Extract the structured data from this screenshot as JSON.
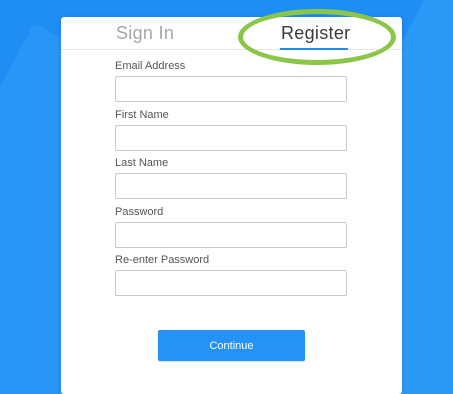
{
  "tabs": {
    "signin_label": "Sign In",
    "register_label": "Register"
  },
  "form": {
    "fields": [
      {
        "label": "Email Address",
        "value": ""
      },
      {
        "label": "First Name",
        "value": ""
      },
      {
        "label": "Last Name",
        "value": ""
      },
      {
        "label": "Password",
        "value": ""
      },
      {
        "label": "Re-enter Password",
        "value": ""
      }
    ],
    "continue_label": "Continue"
  },
  "colors": {
    "background": "#1e8ef4",
    "accent": "#2493f5",
    "highlight_ring": "#8bc64a"
  }
}
